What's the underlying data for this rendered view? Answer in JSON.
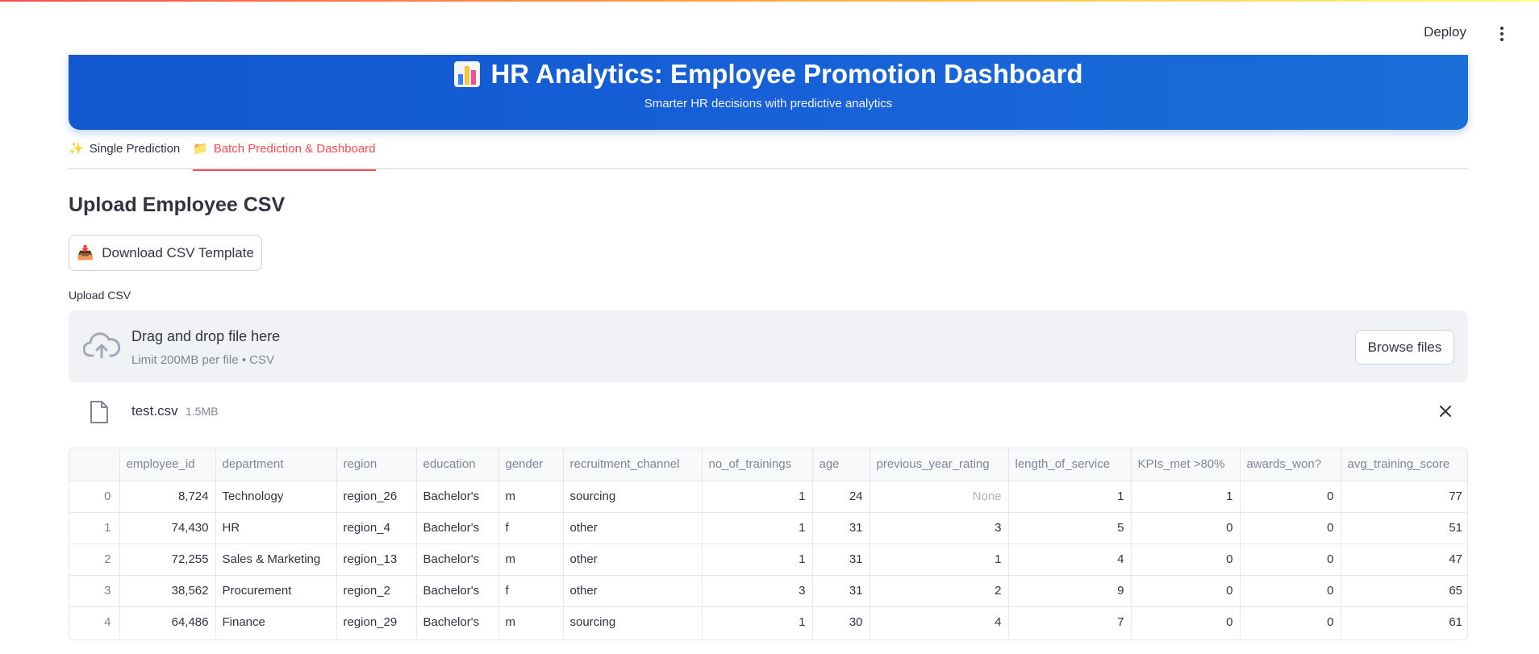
{
  "topbar": {
    "deploy_label": "Deploy",
    "menu_icon": "kebab-menu-icon"
  },
  "header": {
    "icon": "bar-chart-icon",
    "title": "HR Analytics: Employee Promotion Dashboard",
    "subtitle": "Smarter HR decisions with predictive analytics",
    "gradient_colors": [
      "#1157cf",
      "#1a6fd9"
    ]
  },
  "tabs": [
    {
      "icon": "✨",
      "label": "Single Prediction",
      "active": false
    },
    {
      "icon": "📁",
      "label": "Batch Prediction & Dashboard",
      "active": true
    }
  ],
  "accent_color": "#ff4b4b",
  "main": {
    "section_title": "Upload Employee CSV",
    "download_button": {
      "icon": "📥",
      "label": "Download CSV Template"
    },
    "uploader": {
      "label": "Upload CSV",
      "drop_title": "Drag and drop file here",
      "drop_sub": "Limit 200MB per file • CSV",
      "browse_label": "Browse files"
    },
    "file": {
      "name": "test.csv",
      "size": "1.5MB"
    }
  },
  "table": {
    "columns": [
      "",
      "employee_id",
      "department",
      "region",
      "education",
      "gender",
      "recruitment_channel",
      "no_of_trainings",
      "age",
      "previous_year_rating",
      "length_of_service",
      "KPIs_met >80%",
      "awards_won?",
      "avg_training_score"
    ],
    "rows": [
      [
        "0",
        "8,724",
        "Technology",
        "region_26",
        "Bachelor's",
        "m",
        "sourcing",
        "1",
        "24",
        "None",
        "1",
        "1",
        "0",
        "77"
      ],
      [
        "1",
        "74,430",
        "HR",
        "region_4",
        "Bachelor's",
        "f",
        "other",
        "1",
        "31",
        "3",
        "5",
        "0",
        "0",
        "51"
      ],
      [
        "2",
        "72,255",
        "Sales & Marketing",
        "region_13",
        "Bachelor's",
        "m",
        "other",
        "1",
        "31",
        "1",
        "4",
        "0",
        "0",
        "47"
      ],
      [
        "3",
        "38,562",
        "Procurement",
        "region_2",
        "Bachelor's",
        "f",
        "other",
        "3",
        "31",
        "2",
        "9",
        "0",
        "0",
        "65"
      ],
      [
        "4",
        "64,486",
        "Finance",
        "region_29",
        "Bachelor's",
        "m",
        "sourcing",
        "1",
        "30",
        "4",
        "7",
        "0",
        "0",
        "61"
      ]
    ]
  }
}
